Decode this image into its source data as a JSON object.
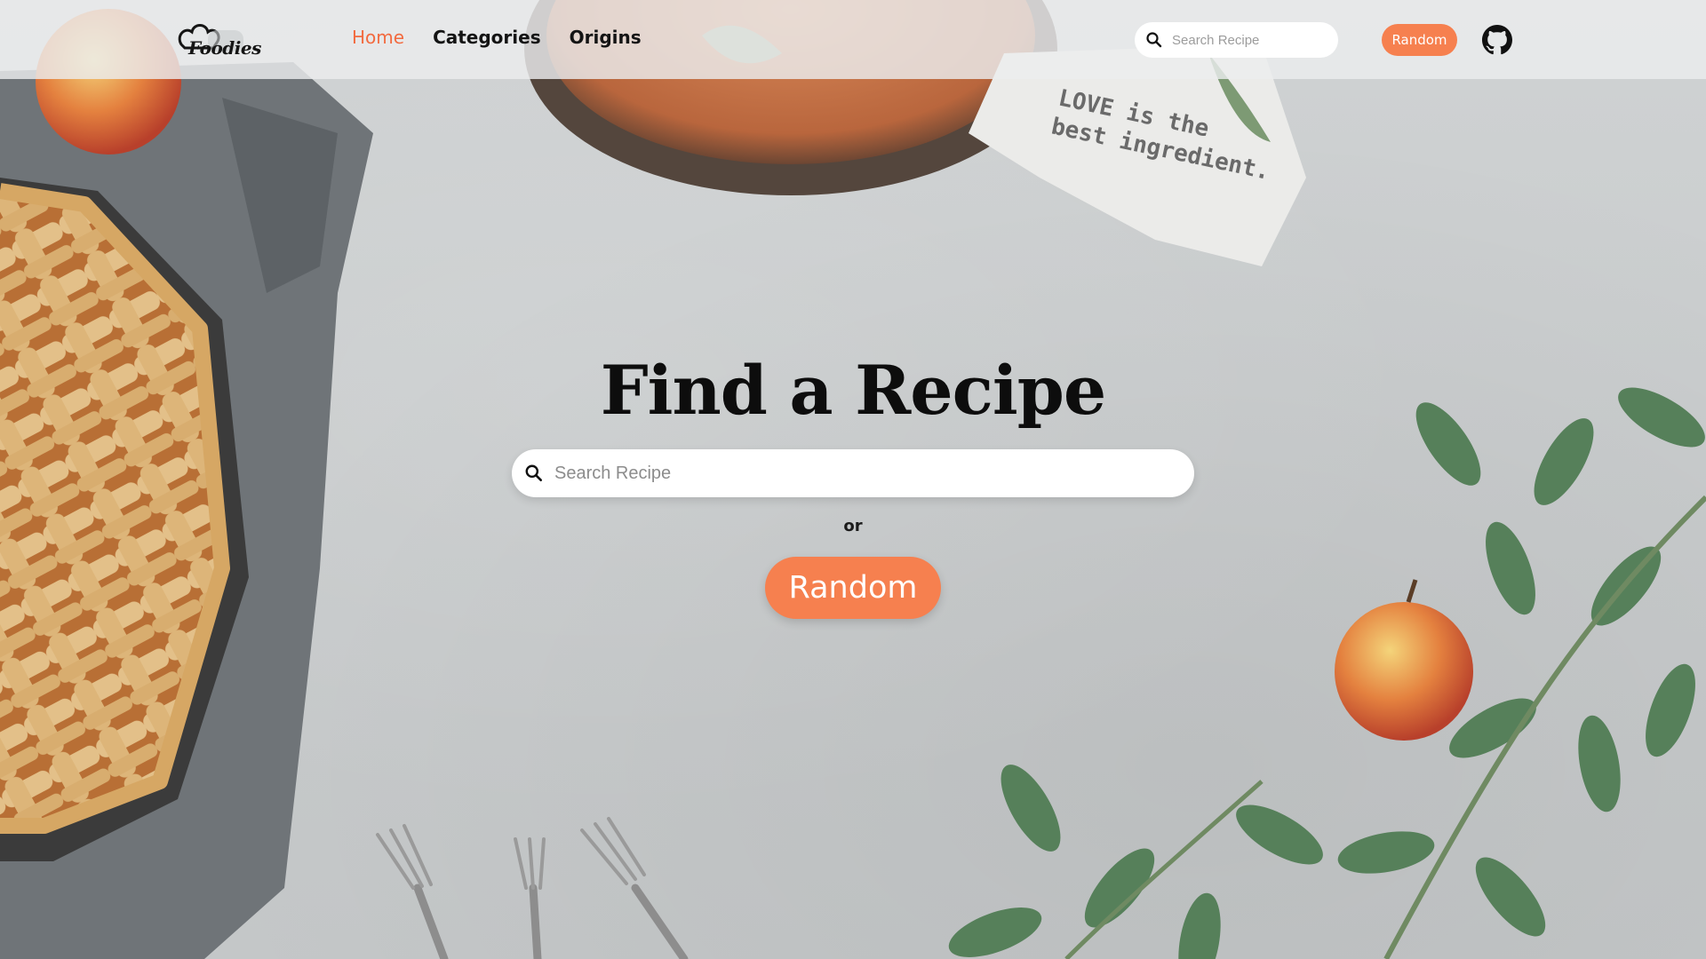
{
  "brand": {
    "name": "Foodies"
  },
  "nav": {
    "links": [
      {
        "label": "Home",
        "active": true
      },
      {
        "label": "Categories",
        "active": false
      },
      {
        "label": "Origins",
        "active": false
      }
    ],
    "search_placeholder": "Search Recipe",
    "random_label": "Random",
    "github_icon": "github-icon"
  },
  "hero": {
    "title": "Find a Recipe",
    "search_placeholder": "Search Recipe",
    "or_text": "or",
    "random_label": "Random"
  },
  "background": {
    "napkin_text_line1": "LOVE is the",
    "napkin_text_line2": "best ingredient."
  },
  "colors": {
    "accent": "#f6804f",
    "active_link": "#f26a3f",
    "text": "#141414"
  }
}
